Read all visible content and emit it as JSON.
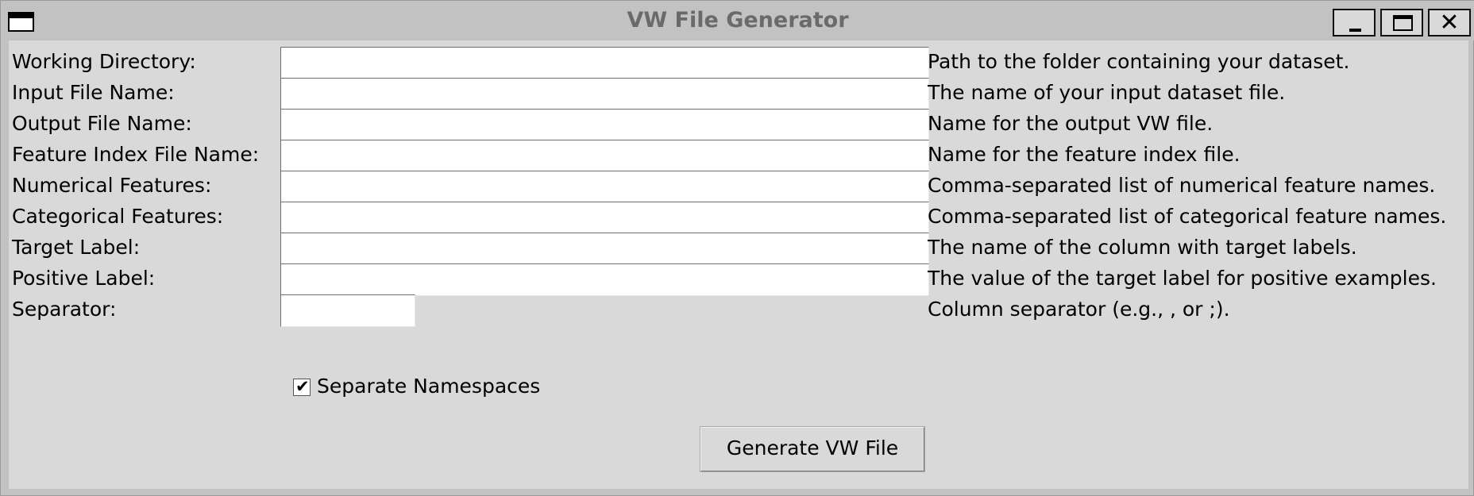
{
  "window": {
    "title": "VW File Generator",
    "close_glyph": "✕"
  },
  "icons": {
    "app": "window-icon",
    "minimize": "minimize-icon",
    "maximize": "maximize-icon",
    "close": "close-icon"
  },
  "form": {
    "fields": [
      {
        "label": "Working Directory:",
        "value": "",
        "help": "Path to the folder containing your dataset."
      },
      {
        "label": "Input File Name:",
        "value": "",
        "help": "The name of your input dataset file."
      },
      {
        "label": "Output File Name:",
        "value": "",
        "help": "Name for the output VW file."
      },
      {
        "label": "Feature Index File Name:",
        "value": "",
        "help": "Name for the feature index file."
      },
      {
        "label": "Numerical Features:",
        "value": "",
        "help": "Comma-separated list of numerical feature names."
      },
      {
        "label": "Categorical Features:",
        "value": "",
        "help": "Comma-separated list of categorical feature names."
      },
      {
        "label": "Target Label:",
        "value": "",
        "help": "The name of the column with target labels."
      },
      {
        "label": "Positive Label:",
        "value": "",
        "help": "The value of the target label for positive examples."
      },
      {
        "label": "Separator:",
        "value": "",
        "help": "Column separator (e.g., , or ;)."
      }
    ],
    "separate_namespaces": {
      "label": "Separate Namespaces",
      "checked": true,
      "check_glyph": "✔"
    },
    "generate_button_label": "Generate VW File"
  }
}
